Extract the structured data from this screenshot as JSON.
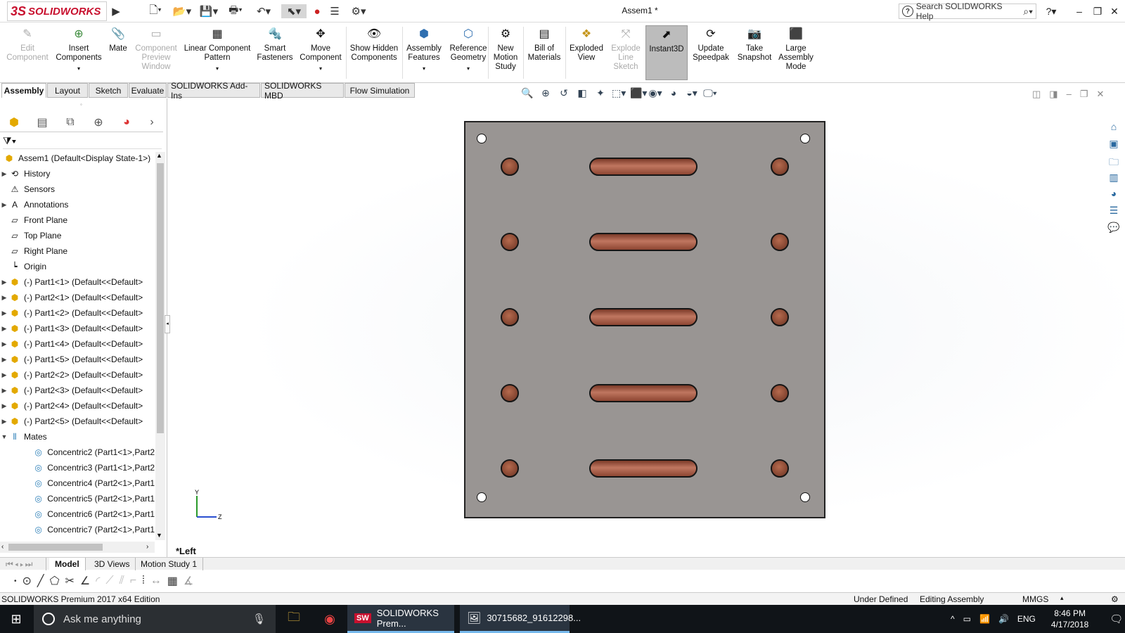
{
  "app": {
    "logo_text": "SOLIDWORKS",
    "document_title": "Assem1 *",
    "search_placeholder": "Search SOLIDWORKS Help"
  },
  "ribbon": {
    "commands": [
      {
        "label": "Edit Component",
        "icon": "edit-component-icon",
        "enabled": false
      },
      {
        "label": "Insert Components",
        "icon": "insert-components-icon",
        "enabled": true
      },
      {
        "label": "Mate",
        "icon": "paperclip-icon",
        "enabled": true
      },
      {
        "label": "Component Preview Window",
        "icon": "preview-window-icon",
        "enabled": false
      },
      {
        "label": "Linear Component Pattern",
        "icon": "pattern-icon",
        "enabled": true
      },
      {
        "label": "Smart Fasteners",
        "icon": "fastener-icon",
        "enabled": true
      },
      {
        "label": "Move Component",
        "icon": "move-icon",
        "enabled": true
      },
      {
        "label": "Show Hidden Components",
        "icon": "show-hidden-icon",
        "enabled": true
      },
      {
        "label": "Assembly Features",
        "icon": "assembly-features-icon",
        "enabled": true
      },
      {
        "label": "Reference Geometry",
        "icon": "reference-geometry-icon",
        "enabled": true
      },
      {
        "label": "New Motion Study",
        "icon": "motion-study-icon",
        "enabled": true
      },
      {
        "label": "Bill of Materials",
        "icon": "bom-icon",
        "enabled": true
      },
      {
        "label": "Exploded View",
        "icon": "exploded-view-icon",
        "enabled": true
      },
      {
        "label": "Explode Line Sketch",
        "icon": "explode-line-icon",
        "enabled": false
      },
      {
        "label": "Instant3D",
        "icon": "instant3d-icon",
        "enabled": true
      },
      {
        "label": "Update Speedpak",
        "icon": "speedpak-icon",
        "enabled": true
      },
      {
        "label": "Take Snapshot",
        "icon": "camera-icon",
        "enabled": true
      },
      {
        "label": "Large Assembly Mode",
        "icon": "large-assembly-icon",
        "enabled": true
      }
    ]
  },
  "tabs": [
    "Assembly",
    "Layout",
    "Sketch",
    "Evaluate",
    "SOLIDWORKS Add-Ins",
    "SOLIDWORKS MBD",
    "Flow Simulation"
  ],
  "tree": {
    "root": "Assem1  (Default<Display State-1>)",
    "items": [
      {
        "label": "History",
        "icon": "history-icon",
        "expand": true
      },
      {
        "label": "Sensors",
        "icon": "sensor-icon",
        "expand": false
      },
      {
        "label": "Annotations",
        "icon": "annotation-icon",
        "expand": true
      },
      {
        "label": "Front Plane",
        "icon": "plane-icon",
        "expand": false
      },
      {
        "label": "Top Plane",
        "icon": "plane-icon",
        "expand": false
      },
      {
        "label": "Right Plane",
        "icon": "plane-icon",
        "expand": false
      },
      {
        "label": "Origin",
        "icon": "origin-icon",
        "expand": false
      },
      {
        "label": "(-) Part1<1> (Default<<Default>",
        "icon": "part-icon",
        "expand": true
      },
      {
        "label": "(-) Part2<1> (Default<<Default>",
        "icon": "part-icon",
        "expand": true
      },
      {
        "label": "(-) Part1<2> (Default<<Default>",
        "icon": "part-icon",
        "expand": true
      },
      {
        "label": "(-) Part1<3> (Default<<Default>",
        "icon": "part-icon",
        "expand": true
      },
      {
        "label": "(-) Part1<4> (Default<<Default>",
        "icon": "part-icon",
        "expand": true
      },
      {
        "label": "(-) Part1<5> (Default<<Default>",
        "icon": "part-icon",
        "expand": true
      },
      {
        "label": "(-) Part2<2> (Default<<Default>",
        "icon": "part-icon",
        "expand": true
      },
      {
        "label": "(-) Part2<3> (Default<<Default>",
        "icon": "part-icon",
        "expand": true
      },
      {
        "label": "(-) Part2<4> (Default<<Default>",
        "icon": "part-icon",
        "expand": true
      },
      {
        "label": "(-) Part2<5> (Default<<Default>",
        "icon": "part-icon",
        "expand": true
      },
      {
        "label": "Mates",
        "icon": "mates-icon",
        "expand": "open"
      }
    ],
    "mates": [
      "Concentric2 (Part1<1>,Part2",
      "Concentric3 (Part1<1>,Part2",
      "Concentric4 (Part2<1>,Part1",
      "Concentric5 (Part2<1>,Part1",
      "Concentric6 (Part2<1>,Part1",
      "Concentric7 (Part2<1>,Part1"
    ]
  },
  "viewport": {
    "view_label": "*Left",
    "triad_y": "Y",
    "triad_z": "Z",
    "plate_color": "#999593",
    "slot_color": "#a85a42"
  },
  "bottom_tabs": [
    "Model",
    "3D Views",
    "Motion Study 1"
  ],
  "status": {
    "edition": "SOLIDWORKS Premium 2017 x64 Edition",
    "definition": "Under Defined",
    "mode": "Editing Assembly",
    "units": "MMGS"
  },
  "taskbar": {
    "search_text": "Ask me anything",
    "apps": [
      "SOLIDWORKS Prem...",
      "30715682_91612298..."
    ],
    "language": "ENG",
    "time": "8:46 PM",
    "date": "4/17/2018"
  }
}
